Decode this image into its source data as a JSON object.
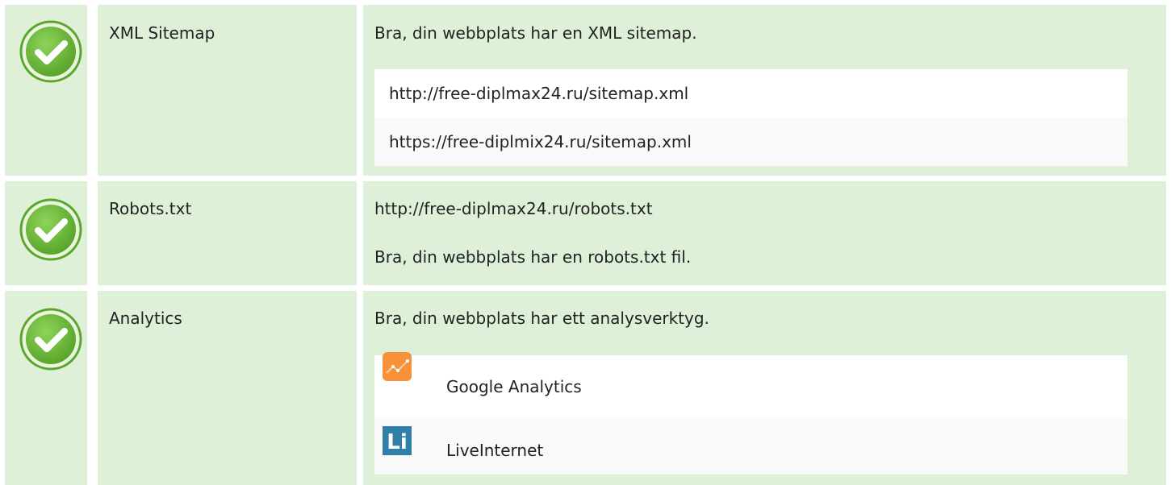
{
  "colors": {
    "row_background": "#dff0d8",
    "check_green": "#6fbf3a",
    "check_border": "#5aa52b",
    "list_background": "#ffffff",
    "list_alt_background": "#f9f9f9",
    "google_analytics_orange": "#f7923a",
    "liveinternet_blue": "#2f7fa8"
  },
  "rows": [
    {
      "status_icon": "check-circle-icon",
      "name": "XML Sitemap",
      "message": "Bra, din webbplats har en XML sitemap.",
      "items": [
        "http://free-diplmax24.ru/sitemap.xml",
        "https://free-diplmix24.ru/sitemap.xml"
      ]
    },
    {
      "status_icon": "check-circle-icon",
      "name": "Robots.txt",
      "url": "http://free-diplmax24.ru/robots.txt",
      "message": "Bra, din webbplats har en robots.txt fil."
    },
    {
      "status_icon": "check-circle-icon",
      "name": "Analytics",
      "message": "Bra, din webbplats har ett analysverktyg.",
      "tools": [
        {
          "icon": "google-analytics-icon",
          "name": "Google Analytics"
        },
        {
          "icon": "liveinternet-icon",
          "icon_text": "Li",
          "name": "LiveInternet"
        }
      ]
    }
  ]
}
